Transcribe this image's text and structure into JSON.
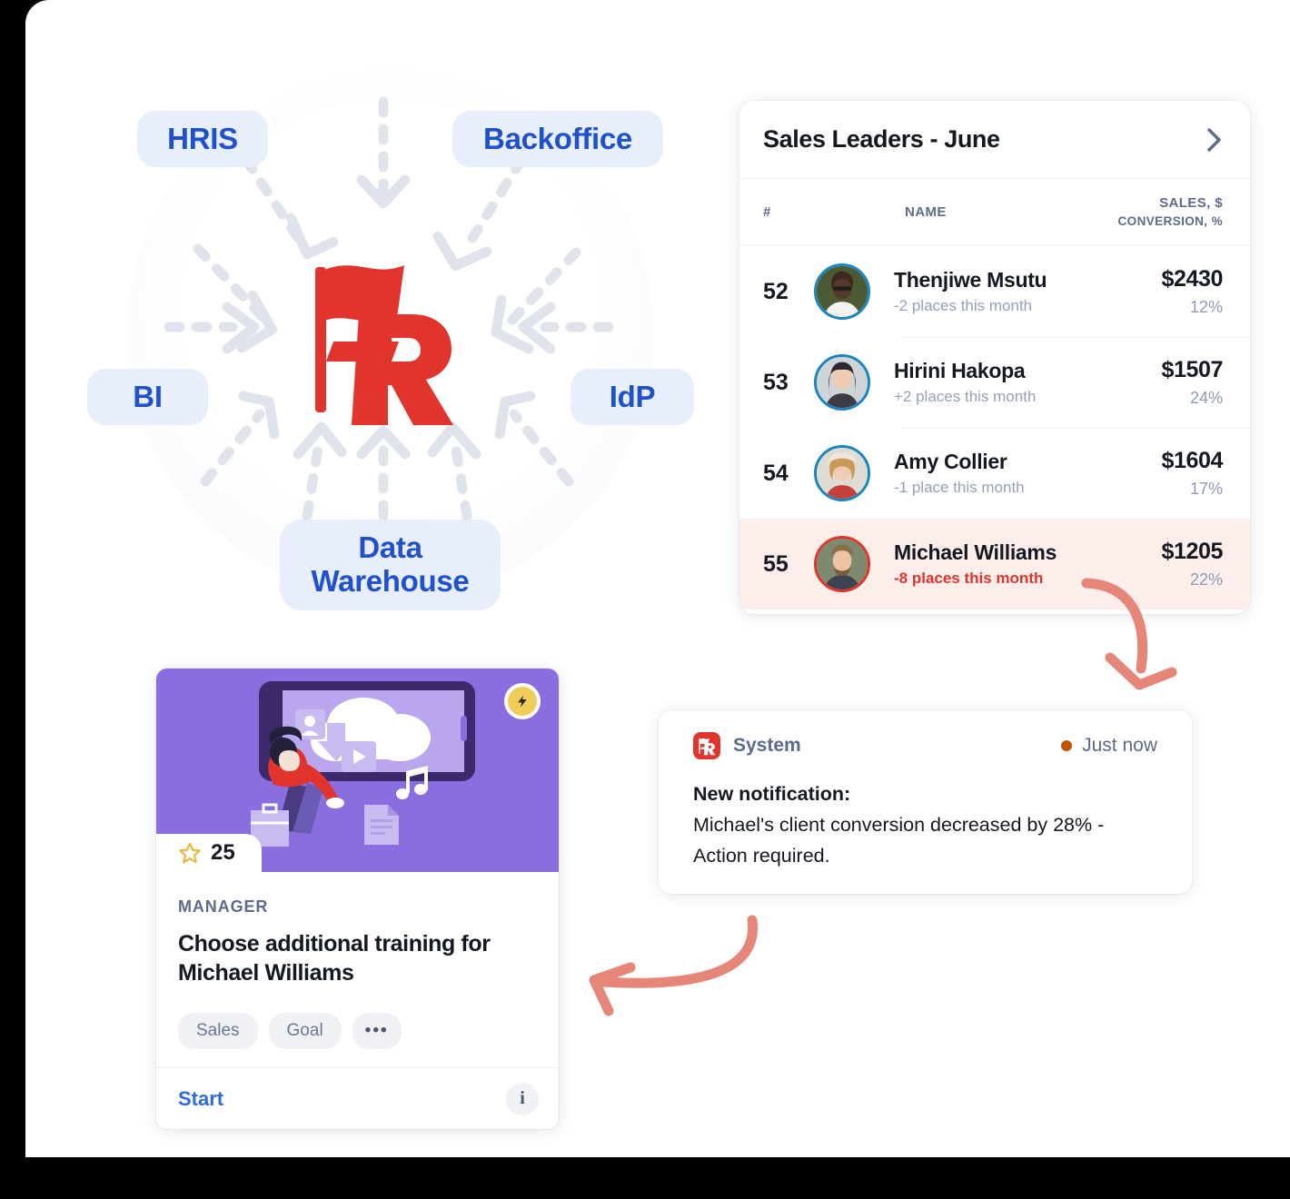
{
  "diagram": {
    "pills": [
      {
        "id": "hris",
        "label": "HRIS"
      },
      {
        "id": "backoffice",
        "label": "Backoffice"
      },
      {
        "id": "bi",
        "label": "BI"
      },
      {
        "id": "idp",
        "label": "IdP"
      },
      {
        "id": "dw_line1",
        "label": "Data"
      },
      {
        "id": "dw_line2",
        "label": "Warehouse"
      }
    ],
    "center_logo": "flag-r-logo",
    "pill_bg": "#e8eefb",
    "pill_text": "#1f51cf",
    "arrow_color": "#dfe4ec"
  },
  "sales_card": {
    "title": "Sales Leaders - June",
    "chevron": "chevron-right-icon",
    "columns": {
      "rank": "#",
      "name": "NAME",
      "sales": "SALES, $",
      "conversion": "CONVERSION, %"
    },
    "rows": [
      {
        "rank": "52",
        "name": "Thenjiwe Msutu",
        "change": "-2 places this month",
        "amount": "$2430",
        "conversion": "12%",
        "alert": false,
        "ring": "#1b86bd"
      },
      {
        "rank": "53",
        "name": "Hirini Hakopa",
        "change": "+2 places this month",
        "amount": "$1507",
        "conversion": "24%",
        "alert": false,
        "ring": "#1b86bd"
      },
      {
        "rank": "54",
        "name": "Amy Collier",
        "change": "-1 place this month",
        "amount": "$1604",
        "conversion": "17%",
        "alert": false,
        "ring": "#1b86bd"
      },
      {
        "rank": "55",
        "name": "Michael Williams",
        "change": "-8 places this month",
        "amount": "$1205",
        "conversion": "22%",
        "alert": true,
        "ring": "#e0342c"
      }
    ],
    "alert_row_bg": "#fdeeeb",
    "alert_text_color": "#e0342c"
  },
  "notification": {
    "logo": "flag-r-app-icon",
    "source": "System",
    "status_dot": "unread-dot-icon",
    "time": "Just now",
    "lead": "New notification:",
    "message": "Michael's client conversion decreased by 28% - Action required.",
    "dot_color": "#c25400"
  },
  "training_card": {
    "hero_illustration": "person-mobile-learning-illustration",
    "bolt_badge": "lightning-bolt-icon",
    "star_icon": "star-icon",
    "star_count": "25",
    "kicker": "MANAGER",
    "title": "Choose additional training for Michael Williams",
    "tags": [
      "Sales",
      "Goal"
    ],
    "more_tag": "•••",
    "start_label": "Start",
    "info_label": "i",
    "hero_bg": "#8a6ee0",
    "start_color": "#2e6ae0"
  },
  "annotations": {
    "arrow_table_to_notification": "curved-arrow-down-icon",
    "arrow_notification_to_card": "curved-arrow-left-icon",
    "arrow_color": "#e58678"
  }
}
